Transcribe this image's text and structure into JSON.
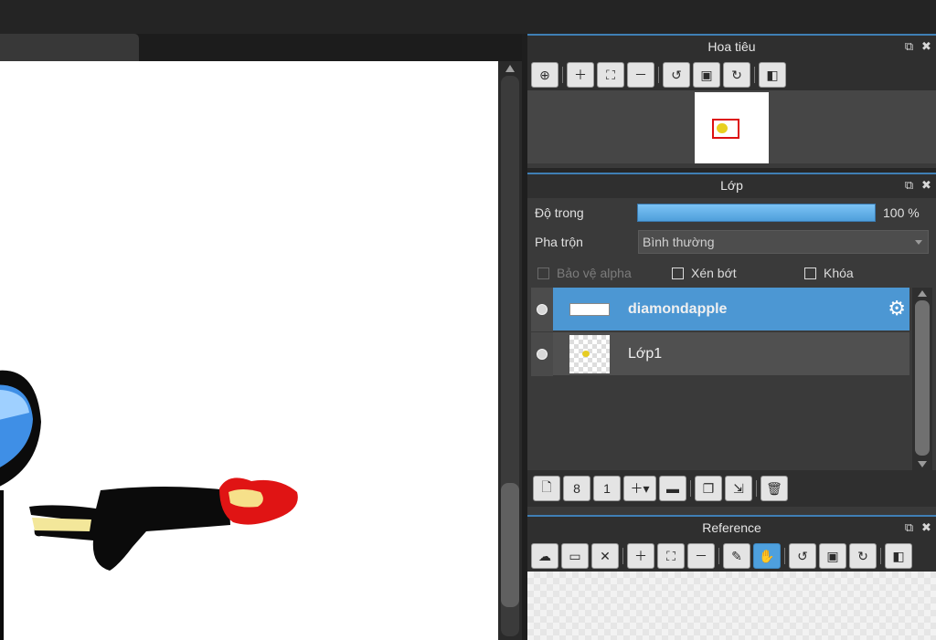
{
  "navigator": {
    "title": "Hoa tiêu",
    "tools": [
      "zoom-fit-icon",
      "zoom-in-icon",
      "fit-screen-icon",
      "zoom-out-icon",
      "rotate-left-icon",
      "actual-size-icon",
      "rotate-right-icon",
      "flip-icon"
    ]
  },
  "layer_panel": {
    "title": "Lớp",
    "opacity_label": "Độ trong",
    "opacity_value": "100 %",
    "opacity_fraction": 1.0,
    "blend_label": "Pha trộn",
    "blend_value": "Bình thường",
    "protect_alpha_label": "Bảo vệ alpha",
    "clipping_label": "Xén bớt",
    "lock_label": "Khóa",
    "layers": [
      {
        "name": "diamondapple",
        "selected": true
      },
      {
        "name": "Lớp1",
        "selected": false
      }
    ],
    "tools": [
      "new-layer-icon",
      "new-8bit-layer-icon",
      "new-1bit-layer-icon",
      "add-layer-menu-icon",
      "folder-icon",
      "duplicate-icon",
      "merge-icon",
      "delete-icon"
    ]
  },
  "reference": {
    "title": "Reference",
    "tools": [
      "upload-icon",
      "open-folder-icon",
      "close-icon",
      "zoom-in-icon",
      "fit-screen-icon",
      "zoom-out-icon",
      "eyedropper-icon",
      "hand-icon",
      "rotate-left-icon",
      "actual-size-icon",
      "rotate-right-icon",
      "flip-icon"
    ]
  },
  "colors": {
    "accent": "#4c97d3",
    "panel_bg": "#3a3a3a",
    "header_bg": "#2f2f2f"
  }
}
